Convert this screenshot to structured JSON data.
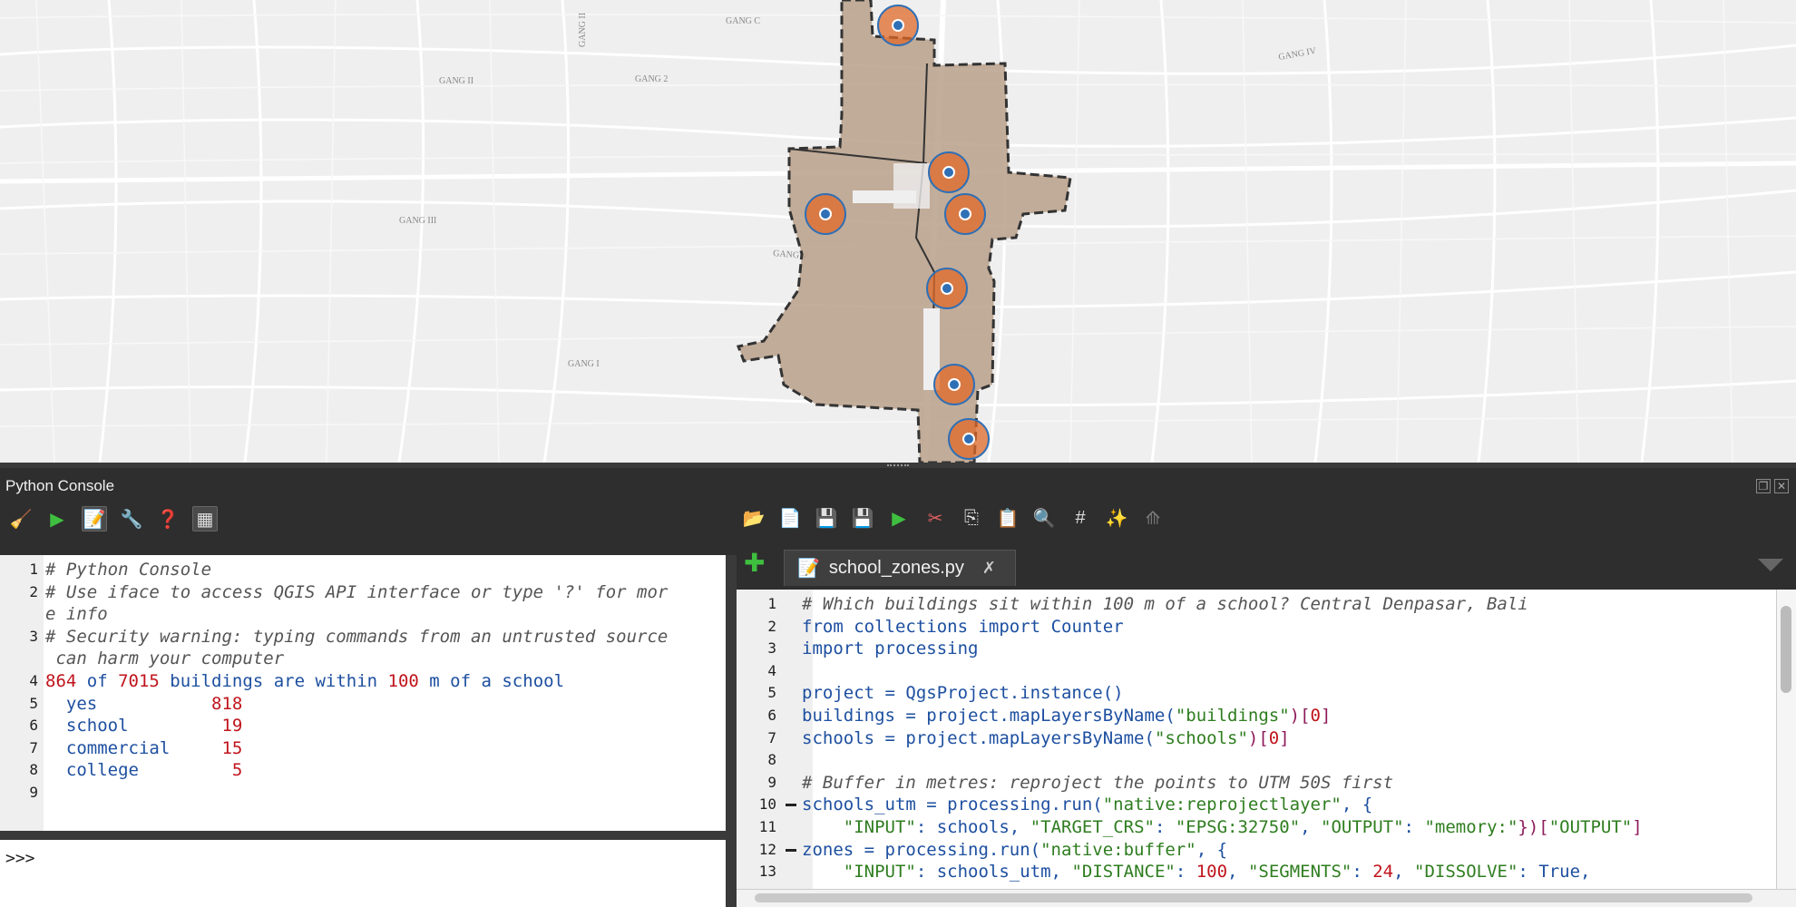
{
  "map": {
    "street_labels": [
      "GANG C",
      "GANG II",
      "GANG 2",
      "GANG II",
      "GANG IV",
      "GANG III",
      "GANG V",
      "GANG I"
    ]
  },
  "console": {
    "title": "Python Console",
    "left_toolbar": [
      {
        "icon": "broom-icon",
        "label": "Clear Console"
      },
      {
        "icon": "run-icon",
        "label": "Run Command"
      },
      {
        "icon": "editor-icon",
        "label": "Show Editor"
      },
      {
        "icon": "wrench-icon",
        "label": "Options"
      },
      {
        "icon": "help-icon",
        "label": "Help"
      },
      {
        "icon": "window-icon",
        "label": "Dock"
      }
    ],
    "right_toolbar": [
      {
        "icon": "open-folder-icon"
      },
      {
        "icon": "open-in-editor-icon"
      },
      {
        "icon": "save-icon"
      },
      {
        "icon": "save-as-icon"
      },
      {
        "icon": "run-script-icon"
      },
      {
        "icon": "cut-icon"
      },
      {
        "icon": "copy-icon"
      },
      {
        "icon": "paste-icon"
      },
      {
        "icon": "find-icon"
      },
      {
        "icon": "comment-icon"
      },
      {
        "icon": "object-inspector-icon"
      },
      {
        "icon": "share-icon"
      }
    ],
    "output_lines": [
      {
        "n": "1",
        "parts": [
          {
            "t": "# Python Console",
            "c": "cm"
          }
        ]
      },
      {
        "n": "2",
        "parts": [
          {
            "t": "# Use iface to access QGIS API interface or type '?' for mor",
            "c": "cm"
          }
        ]
      },
      {
        "n": "",
        "parts": [
          {
            "t": "e info",
            "c": "cm"
          }
        ]
      },
      {
        "n": "3",
        "parts": [
          {
            "t": "# Security warning: typing commands from an untrusted source",
            "c": "cm"
          }
        ]
      },
      {
        "n": "",
        "parts": [
          {
            "t": " can harm your computer",
            "c": "cm"
          }
        ]
      },
      {
        "n": "4",
        "parts": [
          {
            "t": "864",
            "c": "nm"
          },
          {
            "t": " of ",
            "c": "pl"
          },
          {
            "t": "7015",
            "c": "nm"
          },
          {
            "t": " buildings are within ",
            "c": "pl"
          },
          {
            "t": "100",
            "c": "nm"
          },
          {
            "t": " m of a school",
            "c": "pl"
          }
        ]
      },
      {
        "n": "5",
        "parts": [
          {
            "t": "  yes           ",
            "c": "pl"
          },
          {
            "t": "818",
            "c": "nm"
          }
        ]
      },
      {
        "n": "6",
        "parts": [
          {
            "t": "  school         ",
            "c": "pl"
          },
          {
            "t": "19",
            "c": "nm"
          }
        ]
      },
      {
        "n": "7",
        "parts": [
          {
            "t": "  commercial     ",
            "c": "pl"
          },
          {
            "t": "15",
            "c": "nm"
          }
        ]
      },
      {
        "n": "8",
        "parts": [
          {
            "t": "  college         ",
            "c": "pl"
          },
          {
            "t": "5",
            "c": "nm"
          }
        ]
      },
      {
        "n": "9",
        "parts": []
      }
    ],
    "prompt": ">>>",
    "tab": {
      "label": "school_zones.py"
    },
    "code_lines": [
      {
        "n": "1",
        "parts": [
          {
            "t": "# Which buildings sit within 100 m of a school? Central Denpasar, Bali",
            "c": "cm"
          }
        ]
      },
      {
        "n": "2",
        "parts": [
          {
            "t": "from",
            "c": "kw"
          },
          {
            "t": " collections ",
            "c": "df"
          },
          {
            "t": "import",
            "c": "kw"
          },
          {
            "t": " Counter",
            "c": "df"
          }
        ]
      },
      {
        "n": "3",
        "parts": [
          {
            "t": "import",
            "c": "kw"
          },
          {
            "t": " processing",
            "c": "df"
          }
        ]
      },
      {
        "n": "4",
        "parts": []
      },
      {
        "n": "5",
        "parts": [
          {
            "t": "project = QgsProject.instance()",
            "c": "df"
          }
        ]
      },
      {
        "n": "6",
        "parts": [
          {
            "t": "buildings = project.mapLayersByName(",
            "c": "df"
          },
          {
            "t": "\"buildings\"",
            "c": "st"
          },
          {
            "t": ")[",
            "c": "pr"
          },
          {
            "t": "0",
            "c": "nm"
          },
          {
            "t": "]",
            "c": "pr"
          }
        ]
      },
      {
        "n": "7",
        "parts": [
          {
            "t": "schools = project.mapLayersByName(",
            "c": "df"
          },
          {
            "t": "\"schools\"",
            "c": "st"
          },
          {
            "t": ")[",
            "c": "pr"
          },
          {
            "t": "0",
            "c": "nm"
          },
          {
            "t": "]",
            "c": "pr"
          }
        ]
      },
      {
        "n": "8",
        "parts": []
      },
      {
        "n": "9",
        "parts": [
          {
            "t": "# Buffer in metres: reproject the points to UTM 50S first",
            "c": "cm"
          }
        ]
      },
      {
        "n": "10",
        "parts": [
          {
            "t": "schools_utm = processing.run(",
            "c": "df"
          },
          {
            "t": "\"native:reprojectlayer\"",
            "c": "st"
          },
          {
            "t": ", {",
            "c": "df"
          }
        ]
      },
      {
        "n": "11",
        "parts": [
          {
            "t": "    ",
            "c": "df"
          },
          {
            "t": "\"INPUT\"",
            "c": "st"
          },
          {
            "t": ": schools, ",
            "c": "df"
          },
          {
            "t": "\"TARGET_CRS\"",
            "c": "st"
          },
          {
            "t": ": ",
            "c": "df"
          },
          {
            "t": "\"EPSG:32750\"",
            "c": "st"
          },
          {
            "t": ", ",
            "c": "df"
          },
          {
            "t": "\"OUTPUT\"",
            "c": "st"
          },
          {
            "t": ": ",
            "c": "df"
          },
          {
            "t": "\"memory:\"",
            "c": "st"
          },
          {
            "t": "})[",
            "c": "pr"
          },
          {
            "t": "\"OUTPUT\"",
            "c": "st"
          },
          {
            "t": "]",
            "c": "pr"
          }
        ]
      },
      {
        "n": "12",
        "parts": [
          {
            "t": "zones = processing.run(",
            "c": "df"
          },
          {
            "t": "\"native:buffer\"",
            "c": "st"
          },
          {
            "t": ", {",
            "c": "df"
          }
        ]
      },
      {
        "n": "13",
        "parts": [
          {
            "t": "    ",
            "c": "df"
          },
          {
            "t": "\"INPUT\"",
            "c": "st"
          },
          {
            "t": ": schools_utm, ",
            "c": "df"
          },
          {
            "t": "\"DISTANCE\"",
            "c": "st"
          },
          {
            "t": ": ",
            "c": "df"
          },
          {
            "t": "100",
            "c": "nm"
          },
          {
            "t": ", ",
            "c": "df"
          },
          {
            "t": "\"SEGMENTS\"",
            "c": "st"
          },
          {
            "t": ": ",
            "c": "df"
          },
          {
            "t": "24",
            "c": "nm"
          },
          {
            "t": ", ",
            "c": "df"
          },
          {
            "t": "\"DISSOLVE\"",
            "c": "st"
          },
          {
            "t": ": ",
            "c": "df"
          },
          {
            "t": "True",
            "c": "kw"
          },
          {
            "t": ",",
            "c": "df"
          }
        ]
      }
    ]
  }
}
